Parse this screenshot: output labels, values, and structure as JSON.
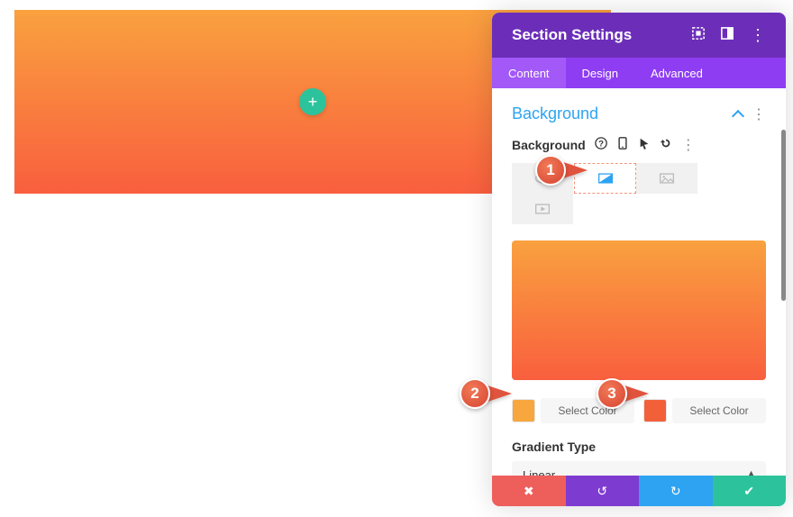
{
  "canvas": {
    "add_label": "+"
  },
  "panel": {
    "title": "Section Settings",
    "tabs": {
      "content": "Content",
      "design": "Design",
      "advanced": "Advanced"
    },
    "group": {
      "title": "Background"
    },
    "field": {
      "label": "Background"
    },
    "color": {
      "swatch1": "#f8a63e",
      "label1": "Select Color",
      "swatch2": "#f2603a",
      "label2": "Select Color"
    },
    "gradient_type": {
      "label": "Gradient Type",
      "value": "Linear"
    }
  },
  "callouts": {
    "c1": "1",
    "c2": "2",
    "c3": "3"
  },
  "icons": {
    "dots": "⋮"
  }
}
